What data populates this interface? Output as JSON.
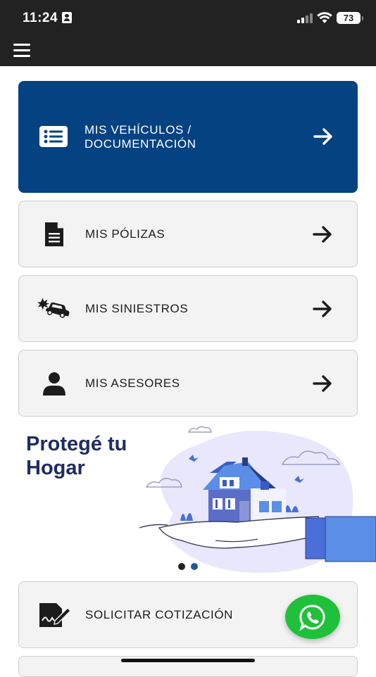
{
  "status_bar": {
    "time": "11:24",
    "battery": "73"
  },
  "menu": {
    "vehicles_label": "MIS VEHÍCULOS / DOCUMENTACIÓN",
    "vehicles_line1": "MIS VEHÍCULOS /",
    "vehicles_line2": "DOCUMENTACIÓN",
    "policies_label": "MIS PÓLIZAS",
    "claims_label": "MIS SINIESTROS",
    "advisors_label": "MIS ASESORES",
    "quote_label": "SOLICITAR COTIZACIÓN"
  },
  "banner": {
    "title_line1": "Protegé tu",
    "title_line2": "Hogar",
    "slides_total": 2,
    "active_slide": 2
  },
  "colors": {
    "primary": "#054282",
    "topbar": "#222222",
    "card_bg": "#f3f3f3",
    "banner_title": "#1f2d63",
    "whatsapp": "#1fc13a"
  },
  "icons": [
    "hamburger-icon",
    "list-icon",
    "document-icon",
    "car-crash-icon",
    "person-icon",
    "signature-icon",
    "arrow-right-icon",
    "whatsapp-icon"
  ]
}
